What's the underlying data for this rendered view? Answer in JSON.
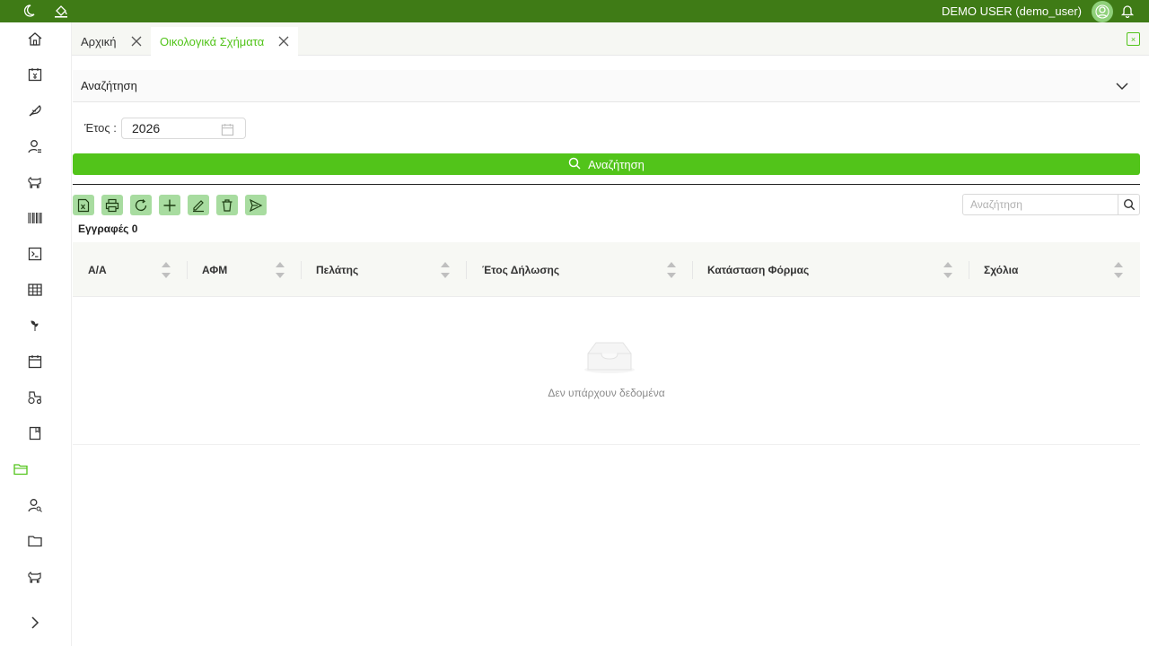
{
  "header": {
    "user": "DEMO USER (demo_user)",
    "theme_bg": "#3f7b16",
    "left_icons": [
      "moon-icon",
      "paint-bucket-icon"
    ]
  },
  "sidebar": {
    "items": [
      "home-icon",
      "calendar-yen-icon",
      "feather-icon",
      "user-list-icon",
      "cow-icon",
      "barcode-icon",
      "terminal-icon",
      "table-icon",
      "plant-icon",
      "calendar-icon",
      "tractor-icon",
      "book-icon",
      "folder-open-icon",
      "user-search-icon",
      "folder-icon",
      "cow-icon",
      "expand-chevron-icon"
    ],
    "active_index": 12
  },
  "tabs": [
    {
      "label": "Αρχική",
      "active": false
    },
    {
      "label": "Οικολογικά Σχήματα",
      "active": true
    }
  ],
  "filter": {
    "panel_title": "Αναζήτηση",
    "year_label": "Έτος :",
    "year_value": "2026",
    "search_button": "Αναζήτηση"
  },
  "toolbar": {
    "buttons": [
      "excel-icon",
      "print-icon",
      "refresh-icon",
      "add-icon",
      "edit-icon",
      "delete-icon",
      "send-icon"
    ],
    "search_placeholder": "Αναζήτηση"
  },
  "table": {
    "records_label": "Εγγραφές 0",
    "columns": [
      "Α/Α",
      "ΑΦΜ",
      "Πελάτης",
      "Έτος Δήλωσης",
      "Κατάσταση Φόρμας",
      "Σχόλια"
    ],
    "empty_text": "Δεν υπάρχουν δεδομένα"
  },
  "colors": {
    "accent": "#52c41a",
    "tool_button": "#a8dca0",
    "header_bg": "#f7f8f4"
  }
}
